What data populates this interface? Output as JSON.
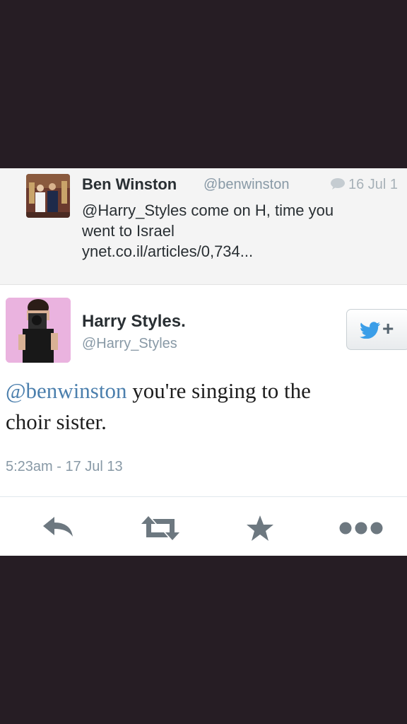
{
  "reply_tweet": {
    "name": "Ben Winston",
    "handle": "@benwinston",
    "date": "16 Jul 1",
    "text_lines": [
      "@Harry_Styles come on H, time you",
      "went to Israel",
      "ynet.co.il/articles/0,734..."
    ]
  },
  "main_tweet": {
    "name": "Harry Styles.",
    "handle": "@Harry_Styles",
    "follow_label": "+",
    "mention": "@benwinston",
    "text_line1_rest": " you're singing to the",
    "text_line2": "choir sister.",
    "timestamp": "5:23am - 17 Jul 13"
  },
  "actions": [
    {
      "icon": "reply-icon"
    },
    {
      "icon": "retweet-icon"
    },
    {
      "icon": "favorite-star-icon"
    },
    {
      "icon": "more-dots-icon"
    }
  ],
  "colors": {
    "background": "#261d24",
    "link": "#4b7fad",
    "twitter_blue": "#3b9ee8",
    "muted": "#8899a6",
    "icon_gray": "#6d7880"
  }
}
